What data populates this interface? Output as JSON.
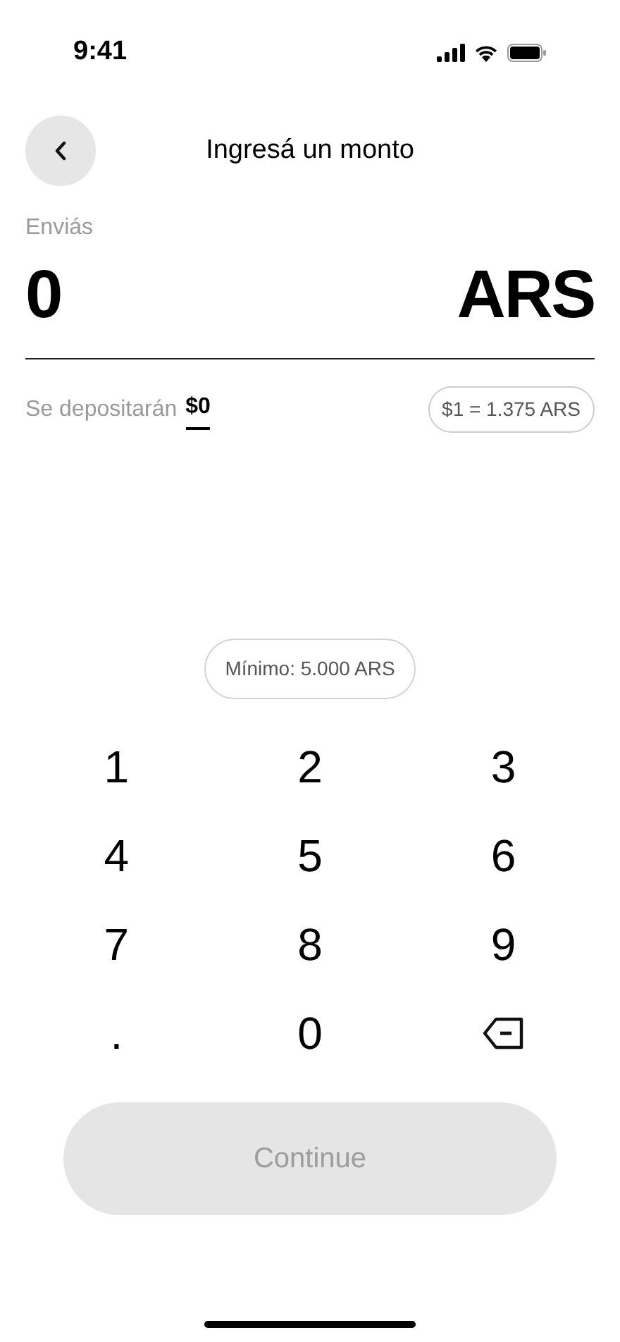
{
  "status_bar": {
    "time": "9:41"
  },
  "header": {
    "title": "Ingresá un monto"
  },
  "amount": {
    "label": "Enviás",
    "value": "0",
    "currency": "ARS"
  },
  "deposit": {
    "label": "Se depositarán",
    "value": "$0",
    "rate": "$1 = 1.375 ARS"
  },
  "minimum": "Mínimo: 5.000 ARS",
  "keypad": [
    {
      "kind": "digit",
      "label": "1"
    },
    {
      "kind": "digit",
      "label": "2"
    },
    {
      "kind": "digit",
      "label": "3"
    },
    {
      "kind": "digit",
      "label": "4"
    },
    {
      "kind": "digit",
      "label": "5"
    },
    {
      "kind": "digit",
      "label": "6"
    },
    {
      "kind": "digit",
      "label": "7"
    },
    {
      "kind": "digit",
      "label": "8"
    },
    {
      "kind": "digit",
      "label": "9"
    },
    {
      "kind": "digit",
      "label": "."
    },
    {
      "kind": "digit",
      "label": "0"
    },
    {
      "kind": "backspace"
    }
  ],
  "continue_button": {
    "label": "Continue",
    "disabled": true
  }
}
